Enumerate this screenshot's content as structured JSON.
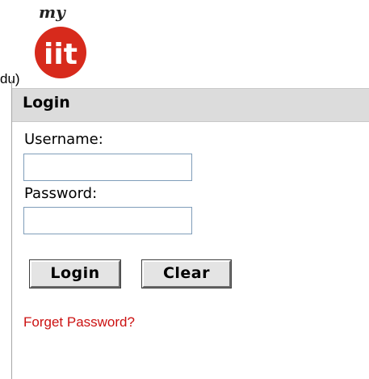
{
  "window": {
    "title_fragment": "du)"
  },
  "logo": {
    "top_text": "my",
    "main_text": "iit",
    "circle_color": "#d72a1c"
  },
  "login_panel": {
    "title": "Login",
    "username_label": "Username:",
    "username_value": "",
    "password_label": "Password:",
    "password_value": "",
    "login_button_label": "Login",
    "clear_button_label": "Clear",
    "forgot_password_link": "Forget Password?"
  },
  "colors": {
    "header_bg": "#dcdcdc",
    "link": "#cc1111",
    "input_border": "#7f9db9"
  }
}
